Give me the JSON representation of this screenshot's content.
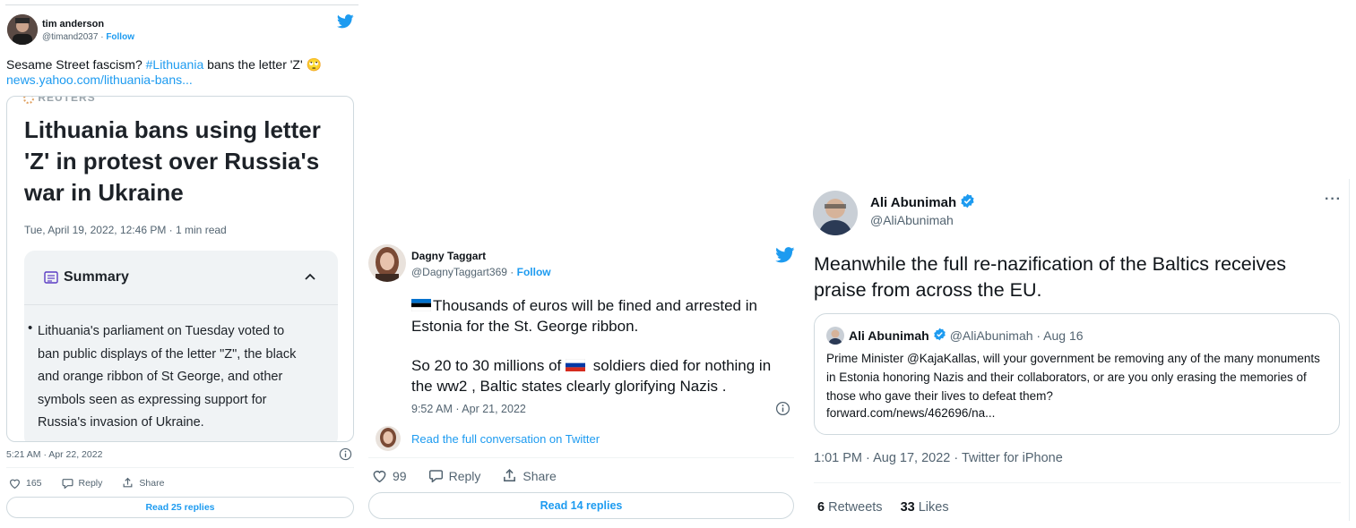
{
  "tweet1": {
    "name": "tim anderson",
    "handle": "@timand2037",
    "follow": "Follow",
    "text_before": "Sesame Street fascism? ",
    "hashtag": "#Lithuania",
    "text_after": " bans the letter 'Z' 🙄",
    "link": "news.yahoo.com/lithuania-bans...",
    "card": {
      "source": "REUTERS",
      "headline": "Lithuania bans using letter 'Z' in protest over Russia's war in Ukraine",
      "date": "Tue, April 19, 2022, 12:46 PM",
      "read_time": "1 min read",
      "summary_title": "Summary",
      "summary_text": "Lithuania's parliament on Tuesday voted to ban public displays of the letter \"Z\", the black and orange ribbon of St George, and other symbols seen as expressing support for Russia's invasion of Ukraine."
    },
    "timestamp": "5:21 AM · Apr 22, 2022",
    "likes": "165",
    "reply": "Reply",
    "share": "Share",
    "read_replies": "Read 25 replies"
  },
  "tweet2": {
    "name": "Dagny Taggart",
    "handle": "@DagnyTaggart369",
    "follow": "Follow",
    "para1": "Thousands of euros will be fined and arrested in Estonia for the St. George ribbon.",
    "para2_a": "So 20 to 30 millions of ",
    "para2_b": " soldiers died for nothing in the ww2 , Baltic states clearly glorifying Nazis .",
    "timestamp": "9:52 AM · Apr 21, 2022",
    "conversation": "Read the full conversation on Twitter",
    "likes": "99",
    "reply": "Reply",
    "share": "Share",
    "read_replies": "Read 14 replies"
  },
  "tweet3": {
    "name": "Ali Abunimah",
    "handle": "@AliAbunimah",
    "more": "···",
    "text": "Meanwhile the full re-nazification of the Baltics receives praise from across the EU.",
    "quote": {
      "name": "Ali Abunimah",
      "handle": "@AliAbunimah · Aug 16",
      "text": "Prime Minister @KajaKallas, will your government be removing any of the many monuments in Estonia honoring Nazis and their collaborators, or are you only erasing the memories of those who gave their lives to defeat them?",
      "link": "forward.com/news/462696/na..."
    },
    "timestamp": "1:01 PM · Aug 17, 2022 · Twitter for iPhone",
    "retweets_count": "6",
    "retweets_label": "Retweets",
    "likes_count": "33",
    "likes_label": "Likes"
  },
  "colors": {
    "accent": "#1d9bf0",
    "text": "#0f1419",
    "muted": "#536471",
    "border": "#cfd9de"
  }
}
